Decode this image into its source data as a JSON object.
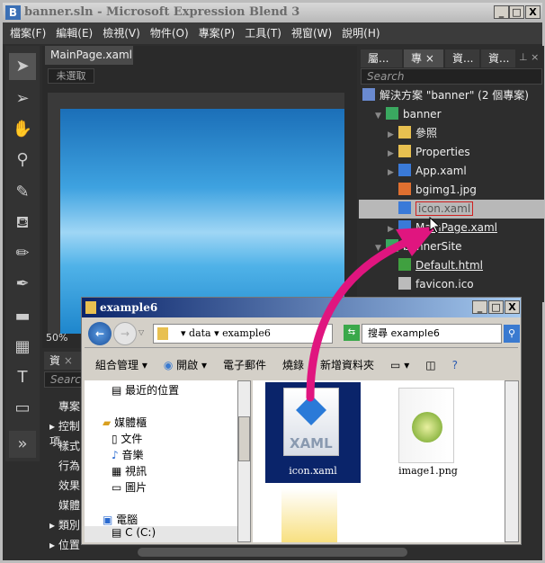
{
  "window": {
    "title": "banner.sln - Microsoft Expression Blend 3",
    "app_icon": "B",
    "controls": [
      "_",
      "□",
      "X"
    ]
  },
  "menu": [
    "檔案(F)",
    "編輯(E)",
    "檢視(V)",
    "物件(O)",
    "專案(P)",
    "工具(T)",
    "視窗(W)",
    "說明(H)"
  ],
  "tools": [
    "selection-icon",
    "direct-selection-icon",
    "pan-icon",
    "zoom-icon",
    "eyedropper-icon",
    "paint-bucket-icon",
    "pencil-icon",
    "pen-icon",
    "rectangle-icon",
    "grid-icon",
    "text-icon",
    "button-control-icon",
    "more-assets-icon"
  ],
  "document": {
    "tab": "MainPage.xaml",
    "close": "×",
    "selection": "未選取",
    "zoom": "50%"
  },
  "right_panel": {
    "tabs": [
      "屬...",
      "專",
      "資...",
      "資..."
    ],
    "search_placeholder": "Search",
    "tree": [
      {
        "label": "解決方案 \"banner\" (2 個專案)",
        "icon": "solution-icon",
        "level": 0
      },
      {
        "label": "banner",
        "icon": "csharp-project-icon",
        "level": 1,
        "expanded": true
      },
      {
        "label": "參照",
        "icon": "folder-icon",
        "level": 2,
        "collapsed": true
      },
      {
        "label": "Properties",
        "icon": "folder-icon",
        "level": 2,
        "collapsed": true
      },
      {
        "label": "App.xaml",
        "icon": "xaml-file-icon",
        "level": 2,
        "collapsed": true
      },
      {
        "label": "bgimg1.jpg",
        "icon": "image-file-icon",
        "level": 2
      },
      {
        "label": "icon.xaml",
        "icon": "xaml-file-icon",
        "level": 2,
        "selected": true
      },
      {
        "label": "MainPage.xaml",
        "icon": "xaml-file-icon",
        "level": 2,
        "collapsed": true
      },
      {
        "label": "bannerSite",
        "icon": "web-project-icon",
        "level": 1,
        "expanded": true
      },
      {
        "label": "Default.html",
        "icon": "html-file-icon",
        "level": 2
      },
      {
        "label": "favicon.ico",
        "icon": "ico-file-icon",
        "level": 2
      }
    ]
  },
  "left_panel": {
    "tab": "資",
    "close": "×",
    "search_placeholder": "Search",
    "items": [
      "專案",
      "控制項",
      "樣式",
      "行為",
      "效果",
      "媒體",
      "類別",
      "位置"
    ]
  },
  "explorer": {
    "title": "example6",
    "path": [
      "data",
      "example6"
    ],
    "search": "搜尋 example6",
    "commands": [
      "組合管理 ▾",
      "開啟 ▾",
      "電子郵件",
      "燒錄",
      "新增資料夾"
    ],
    "nav": [
      {
        "label": "最近的位置"
      },
      {
        "label": "媒體櫃",
        "group": true
      },
      {
        "label": "文件"
      },
      {
        "label": "音樂"
      },
      {
        "label": "視訊"
      },
      {
        "label": "圖片"
      },
      {
        "label": "電腦",
        "group": true
      },
      {
        "label": "C (C:)"
      }
    ],
    "files": [
      {
        "name": "icon.xaml",
        "badge": "XAML",
        "selected": true
      },
      {
        "name": "image1.png"
      }
    ]
  },
  "colors": {
    "drag_arrow": "#e0157f",
    "selection_bg": "#0a246a"
  }
}
